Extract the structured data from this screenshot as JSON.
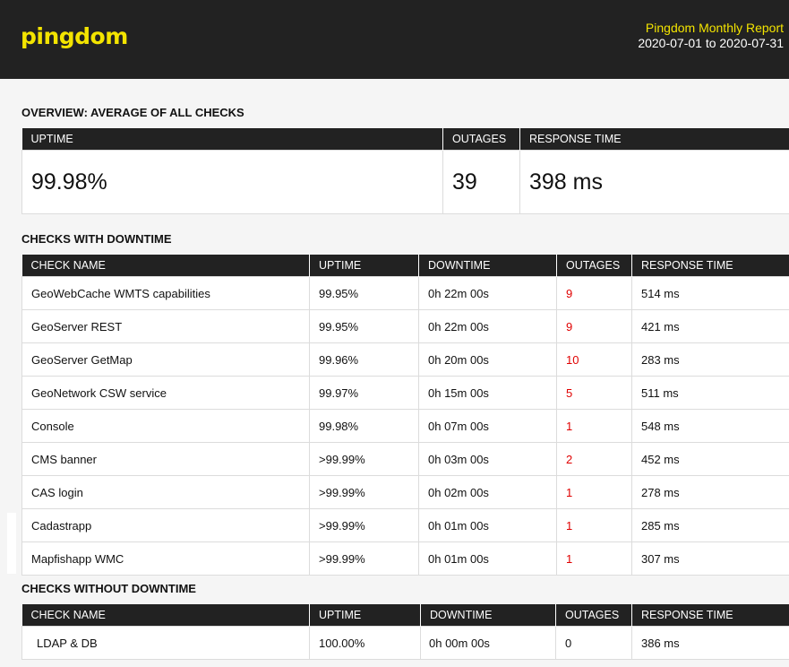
{
  "header": {
    "logo": "pingdom",
    "report_title": "Pingdom Monthly Report",
    "report_range": "2020-07-01 to 2020-07-31",
    "accent_color": "#f3e400",
    "background_color": "#222222"
  },
  "overview": {
    "title": "OVERVIEW: AVERAGE OF ALL CHECKS",
    "headers": [
      "UPTIME",
      "OUTAGES",
      "RESPONSE TIME"
    ],
    "values": [
      "99.98%",
      "39",
      "398 ms"
    ]
  },
  "downtime": {
    "title": "CHECKS WITH DOWNTIME",
    "headers": [
      "CHECK NAME",
      "UPTIME",
      "DOWNTIME",
      "OUTAGES",
      "RESPONSE TIME"
    ],
    "rows": [
      [
        "GeoWebCache WMTS capabilities",
        "99.95%",
        "0h 22m 00s",
        "9",
        "514 ms"
      ],
      [
        "GeoServer REST",
        "99.95%",
        "0h 22m 00s",
        "9",
        "421 ms"
      ],
      [
        "GeoServer GetMap",
        "99.96%",
        "0h 20m 00s",
        "10",
        "283 ms"
      ],
      [
        "GeoNetwork CSW service",
        "99.97%",
        "0h 15m 00s",
        "5",
        "511 ms"
      ],
      [
        "Console",
        "99.98%",
        "0h 07m 00s",
        "1",
        "548 ms"
      ],
      [
        "CMS banner",
        ">99.99%",
        "0h 03m 00s",
        "2",
        "452 ms"
      ],
      [
        "CAS login",
        ">99.99%",
        "0h 02m 00s",
        "1",
        "278 ms"
      ],
      [
        "Cadastrapp",
        ">99.99%",
        "0h 01m 00s",
        "1",
        "285 ms"
      ],
      [
        "Mapfishapp WMC",
        ">99.99%",
        "0h 01m 00s",
        "1",
        "307 ms"
      ]
    ],
    "outage_color": "#e00000"
  },
  "no_downtime": {
    "title": "CHECKS WITHOUT DOWNTIME",
    "headers": [
      "CHECK NAME",
      "UPTIME",
      "DOWNTIME",
      "OUTAGES",
      "RESPONSE TIME"
    ],
    "rows": [
      [
        "LDAP & DB",
        "100.00%",
        "0h 00m 00s",
        "0",
        "386 ms"
      ]
    ]
  }
}
